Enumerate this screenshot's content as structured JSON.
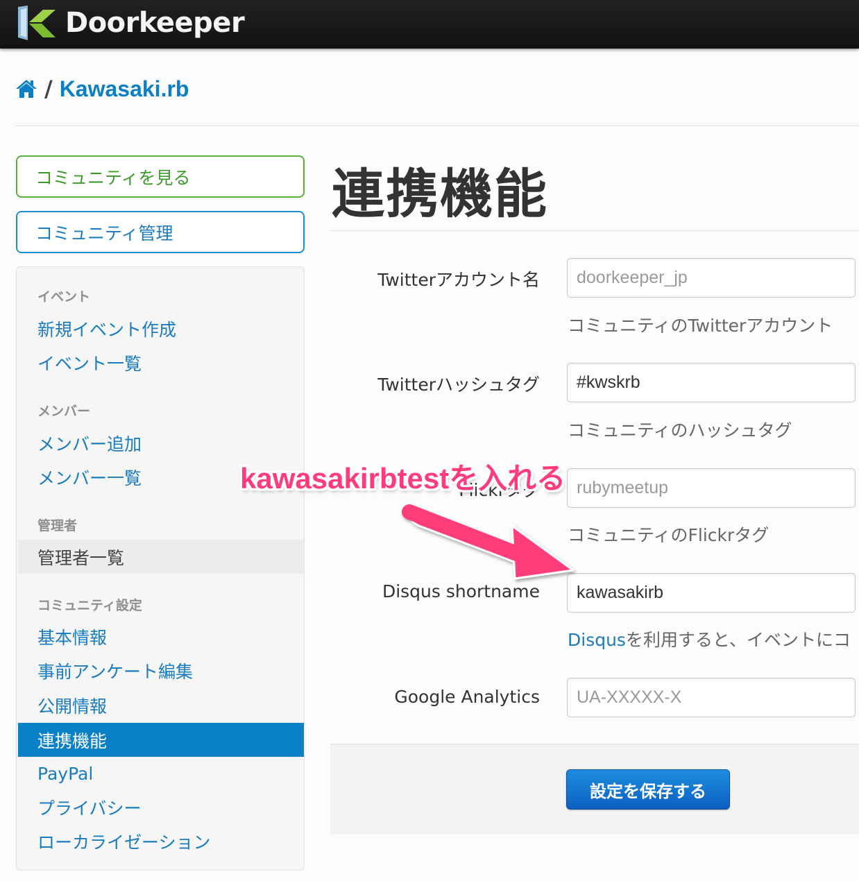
{
  "header": {
    "logo_text": "Doorkeeper"
  },
  "breadcrumb": {
    "separator": "/",
    "community": "Kawasaki.rb"
  },
  "sidebar": {
    "view_community": "コミュニティを見る",
    "manage_community": "コミュニティ管理",
    "sections": {
      "events": {
        "header": "イベント",
        "new_event": "新規イベント作成",
        "event_list": "イベント一覧"
      },
      "members": {
        "header": "メンバー",
        "add_member": "メンバー追加",
        "member_list": "メンバー一覧"
      },
      "admins": {
        "header": "管理者",
        "admin_list": "管理者一覧"
      },
      "settings": {
        "header": "コミュニティ設定",
        "basic_info": "基本情報",
        "questionnaire": "事前アンケート編集",
        "public_info": "公開情報",
        "integrations": "連携機能",
        "paypal": "PayPal",
        "privacy": "プライバシー",
        "localization": "ローカライゼーション"
      }
    }
  },
  "main": {
    "title": "連携機能",
    "twitter_account": {
      "label": "Twitterアカウント名",
      "placeholder": "doorkeeper_jp",
      "help": "コミュニティのTwitterアカウント"
    },
    "twitter_hashtag": {
      "label": "Twitterハッシュタグ",
      "value": "#kwskrb",
      "help": "コミュニティのハッシュタグ"
    },
    "flickr_tag": {
      "label": "Flickrタグ",
      "placeholder": "rubymeetup",
      "help": "コミュニティのFlickrタグ"
    },
    "disqus": {
      "label": "Disqus shortname",
      "value": "kawasakirb",
      "help_link": "Disqus",
      "help_text": "を利用すると、イベントにコ"
    },
    "google_analytics": {
      "label": "Google Analytics",
      "placeholder": "UA-XXXXX-X"
    },
    "save_button": "設定を保存する"
  },
  "annotation": {
    "text": "kawasakirbtestを入れる",
    "color": "#ff3d7a"
  },
  "colors": {
    "link": "#1a7cc0",
    "active_nav": "#0a80c9",
    "primary_button": "#1e8ee0"
  }
}
